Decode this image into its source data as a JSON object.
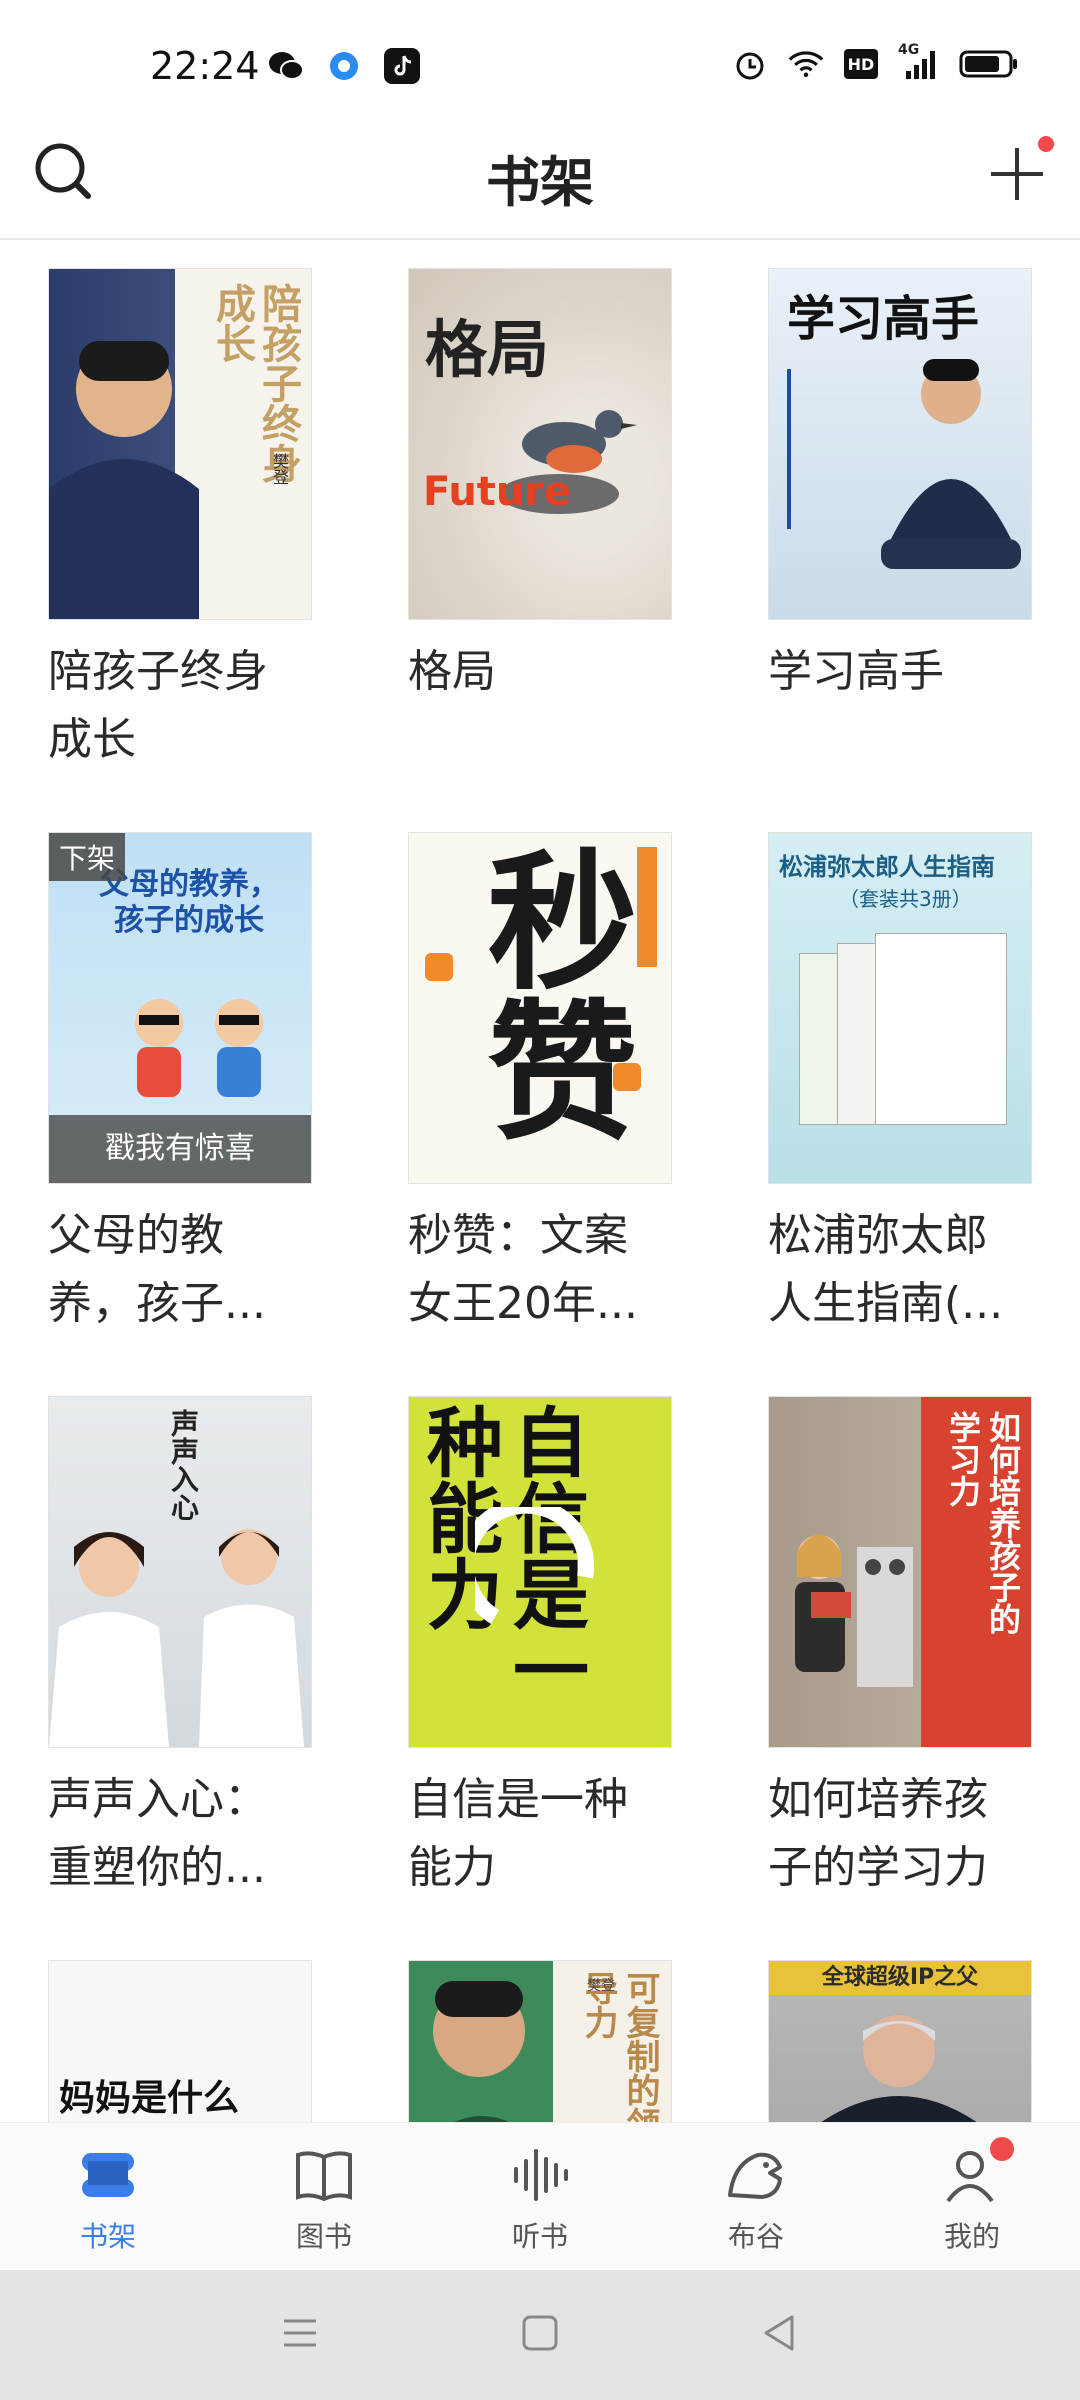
{
  "status_bar": {
    "time": "22:24",
    "app_icons": [
      "wechat-icon",
      "circle-app-icon",
      "tiktok-icon"
    ],
    "system_icons": [
      "alarm-icon",
      "wifi-icon",
      "hd-icon",
      "signal-4g-icon",
      "battery-icon"
    ],
    "hd_label": "HD",
    "network_label": "4G"
  },
  "header": {
    "title": "书架"
  },
  "books": [
    {
      "title": "陪孩子终身成长",
      "cover_text": "陪孩子终身成长",
      "cover_author": "樊登"
    },
    {
      "title": "格局",
      "cover_text": "格局",
      "cover_sub": "Future"
    },
    {
      "title": "学习高手",
      "cover_text": "学习高手"
    },
    {
      "title": "父母的教养，孩子...",
      "cover_text": "父母的教养，孩子的成长",
      "tag": "下架",
      "banner": "戳我有惊喜"
    },
    {
      "title": "秒赞：文案女王20年...",
      "cover_text": "秒赞"
    },
    {
      "title": "松浦弥太郎人生指南(...",
      "cover_text": "松浦弥太郎人生指南",
      "cover_sub": "（套装共3册）"
    },
    {
      "title": "声声入心：重塑你的...",
      "cover_text": "声声入心"
    },
    {
      "title": "自信是一种能力",
      "cover_text": "自信是一种能力"
    },
    {
      "title": "如何培养孩子的学习力",
      "cover_text": "如何培养孩子的学习力"
    },
    {
      "title": "",
      "cover_text": "妈妈是什么"
    },
    {
      "title": "",
      "cover_text": "可复制的领导力",
      "cover_author": "樊登"
    },
    {
      "title": "",
      "cover_text": "全球超级IP之父"
    }
  ],
  "bottom_nav": [
    {
      "label": "书架",
      "icon": "bookshelf-icon",
      "active": true
    },
    {
      "label": "图书",
      "icon": "open-book-icon",
      "active": false
    },
    {
      "label": "听书",
      "icon": "audio-wave-icon",
      "active": false
    },
    {
      "label": "布谷",
      "icon": "bird-icon",
      "active": false
    },
    {
      "label": "我的",
      "icon": "user-icon",
      "active": false,
      "badge": true
    }
  ],
  "system_nav": [
    "menu-icon",
    "home-icon",
    "back-icon"
  ],
  "colors": {
    "accent": "#3b7de6",
    "badge": "#f24a4a",
    "nav_bg": "#fafafa",
    "sys_nav_bg": "#e4e4e4"
  }
}
